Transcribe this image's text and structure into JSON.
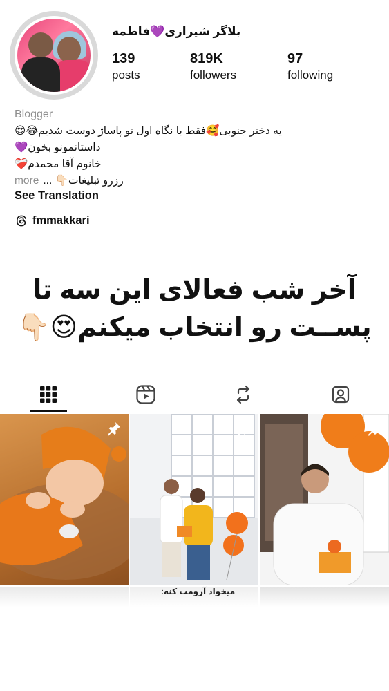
{
  "profile": {
    "username": "بلاگر شیرازی💜فاطمه",
    "stats": {
      "posts": {
        "value": "139",
        "label": "posts"
      },
      "followers": {
        "value": "819K",
        "label": "followers"
      },
      "following": {
        "value": "97",
        "label": "following"
      }
    },
    "category": "Blogger",
    "bio_lines": [
      "یه دختر جنوبی🥰فقط با نگاه اول تو پاساژ دوست شدیم😂😍",
      "داستانمونو بخون💜",
      "خانوم آقا محمدم❤️‍🩹"
    ],
    "bio_last_line": "رزرو تبلیغات👇🏻 ...",
    "more_label": "more",
    "see_translation": "See Translation",
    "threads_handle": "fmmakkari"
  },
  "caption": {
    "line1": "آخر شب فعالای این سه تا",
    "line2": "پســت رو انتخاب میکنم😍👇🏻"
  },
  "tabs": [
    {
      "name": "posts-grid",
      "icon": "grid-icon"
    },
    {
      "name": "reels",
      "icon": "reels-icon"
    },
    {
      "name": "reposts",
      "icon": "repost-icon"
    },
    {
      "name": "tagged",
      "icon": "tagged-icon"
    }
  ],
  "grid_strip_text": "میخواد آرومت کنه:",
  "colors": {
    "text": "#111111",
    "muted": "#8e8e8e",
    "accent_orange": "#f07d1a"
  }
}
